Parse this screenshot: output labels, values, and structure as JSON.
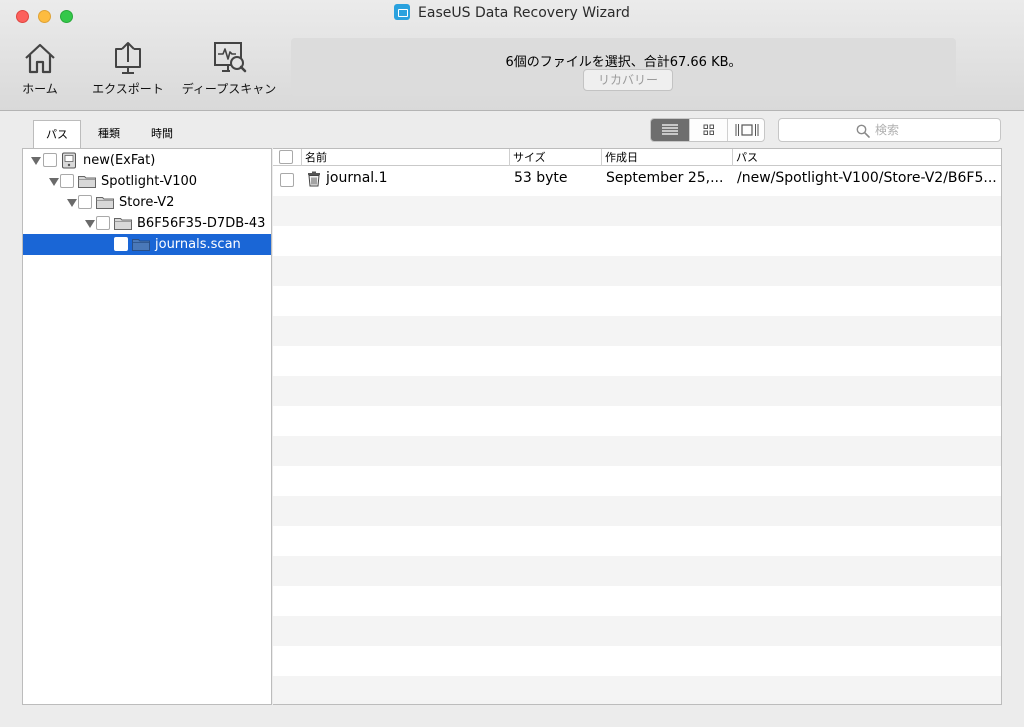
{
  "window": {
    "title": "EaseUS Data Recovery Wizard"
  },
  "toolbar": {
    "home_label": "ホーム",
    "export_label": "エクスポート",
    "deep_scan_label": "ディープスキャン"
  },
  "status": {
    "message": "6個のファイルを選択、合計67.66 KB。",
    "recover_label": "リカバリー"
  },
  "left_tabs": [
    {
      "label": "パス",
      "active": true
    },
    {
      "label": "種類",
      "active": false
    },
    {
      "label": "時間",
      "active": false
    }
  ],
  "view_modes": [
    "list-view-icon",
    "grid-view-icon",
    "filmstrip-view-icon"
  ],
  "search": {
    "placeholder": "検索"
  },
  "tree": {
    "nodes": [
      {
        "label": "new(ExFat)",
        "icon": "drive-icon",
        "expanded": true,
        "level": 0
      },
      {
        "label": "Spotlight-V100",
        "icon": "folder-icon",
        "expanded": true,
        "level": 1
      },
      {
        "label": "Store-V2",
        "icon": "folder-icon",
        "expanded": true,
        "level": 2
      },
      {
        "label": "B6F56F35-D7DB-43",
        "icon": "folder-icon",
        "expanded": true,
        "level": 3
      },
      {
        "label": "journals.scan",
        "icon": "folder-icon",
        "expanded": false,
        "level": 4,
        "selected": true
      }
    ]
  },
  "table": {
    "columns": [
      "名前",
      "サイズ",
      "作成日",
      "パス"
    ],
    "rows": [
      {
        "name": "journal.1",
        "icon": "trash-icon",
        "size": "53 byte",
        "created": "September 25,...",
        "path": "/new/Spotlight-V100/Store-V2/B6F5..."
      }
    ]
  },
  "colors": {
    "selection": "#1a66d6",
    "stripe": "#f4f4f4"
  }
}
